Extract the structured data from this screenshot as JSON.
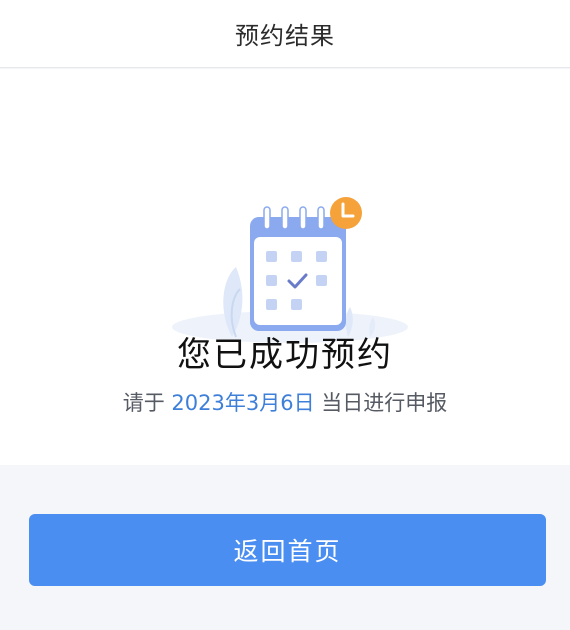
{
  "header": {
    "title": "预约结果"
  },
  "main": {
    "illustration_icon": "calendar-check-clock-icon",
    "success_title": "您已成功预约",
    "result_prefix": "请于",
    "result_date": "2023年3月6日",
    "result_suffix": "当日进行申报"
  },
  "footer": {
    "home_button_label": "返回首页"
  },
  "colors": {
    "accent": "#4b8ef1",
    "date_text": "#3d7fd9",
    "clock_badge": "#f5a23b",
    "page_background": "#f4f6fa"
  }
}
